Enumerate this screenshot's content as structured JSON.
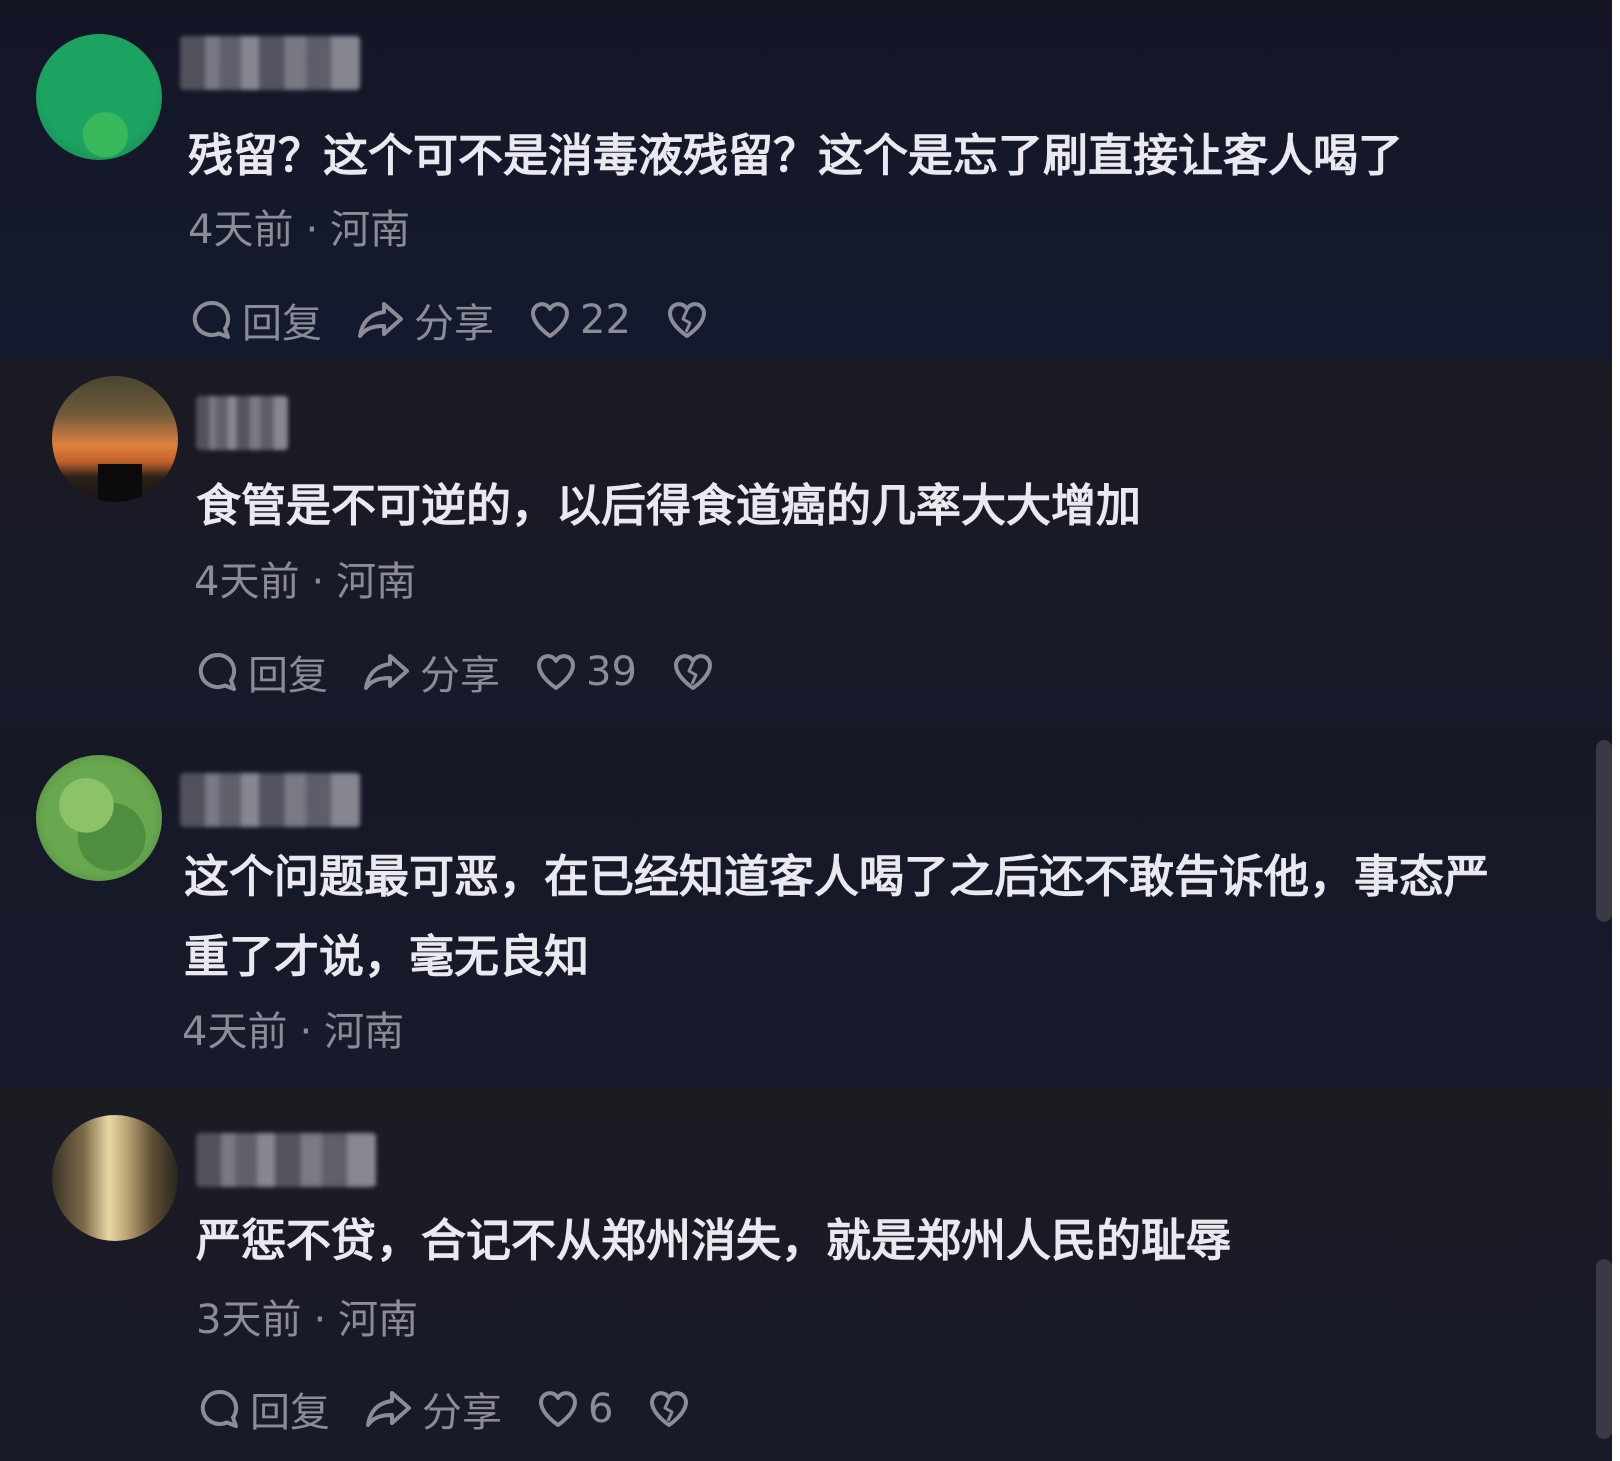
{
  "labels": {
    "reply": "回复",
    "share": "分享"
  },
  "comments": [
    {
      "text": "残留？这个可不是消毒液残留？这个是忘了刷直接让客人喝了",
      "time": "4天前",
      "location": "河南",
      "likes": "22"
    },
    {
      "text": "食管是不可逆的，以后得食道癌的几率大大增加",
      "time": "4天前",
      "location": "河南",
      "likes": "39"
    },
    {
      "text": "这个问题最可恶，在已经知道客人喝了之后还不敢告诉他，事态严重了才说，毫无良知",
      "time": "4天前",
      "location": "河南"
    },
    {
      "text": "严惩不贷，合记不从郑州消失，就是郑州人民的耻辱",
      "time": "3天前",
      "location": "河南",
      "likes": "6"
    }
  ],
  "icons": {
    "reply": "speech-bubble-icon",
    "share": "share-arrow-icon",
    "like": "heart-icon",
    "dislike": "broken-heart-icon"
  },
  "colors": {
    "background": "#15151f",
    "text": "#e9e9ef",
    "meta": "#8c8c96"
  }
}
